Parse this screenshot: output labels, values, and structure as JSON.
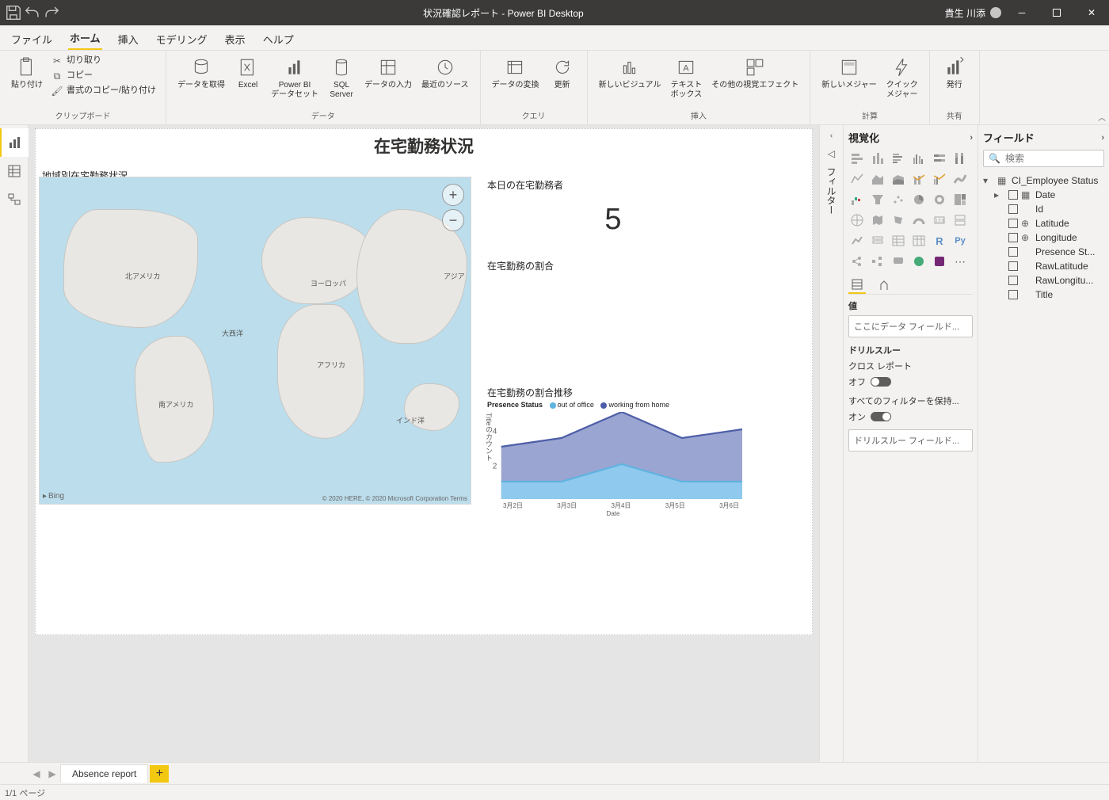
{
  "app_title": "状況確認レポート - Power BI Desktop",
  "user_name": "貴生 川添",
  "ribbon_tabs": [
    "ファイル",
    "ホーム",
    "挿入",
    "モデリング",
    "表示",
    "ヘルプ"
  ],
  "active_tab": "ホーム",
  "ribbon": {
    "clipboard": {
      "label": "クリップボード",
      "paste": "貼り付け",
      "cut": "切り取り",
      "copy": "コピー",
      "format_painter": "書式のコピー/貼り付け"
    },
    "data": {
      "label": "データ",
      "get_data": "データを取得",
      "excel": "Excel",
      "pbi_dataset": "Power BI\nデータセット",
      "sql": "SQL\nServer",
      "enter_data": "データの入力",
      "recent": "最近のソース"
    },
    "query": {
      "label": "クエリ",
      "transform": "データの変換",
      "refresh": "更新"
    },
    "insert": {
      "label": "挿入",
      "new_visual": "新しいビジュアル",
      "text_box": "テキスト\nボックス",
      "more_visuals": "その他の視覚エフェクト"
    },
    "calc": {
      "label": "計算",
      "new_measure": "新しいメジャー",
      "quick_measure": "クイック\nメジャー"
    },
    "share": {
      "label": "共有",
      "publish": "発行"
    }
  },
  "report": {
    "title": "在宅勤務状況",
    "map_title": "地域別在宅勤務状況",
    "map_labels": {
      "na": "北アメリカ",
      "sa": "南アメリカ",
      "eu": "ヨーロッパ",
      "af": "アフリカ",
      "as": "アジア",
      "indian": "インド洋",
      "pacific": "大西洋"
    },
    "map_credit": "© 2020 HERE, © 2020 Microsoft Corporation Terms",
    "map_bing": "Bing",
    "kpi_title": "本日の在宅勤務者",
    "kpi_value": "5",
    "ratio_title": "在宅勤務の割合",
    "trend_title": "在宅勤務の割合推移",
    "trend_legend_title": "Presence Status",
    "trend_series1": "out of office",
    "trend_series2": "working from home",
    "trend_ylabel": "Titleのカウント",
    "trend_xlabel": "Date"
  },
  "chart_data": {
    "type": "area",
    "x": [
      "3月2日",
      "3月3日",
      "3月4日",
      "3月5日",
      "3月6日"
    ],
    "series": [
      {
        "name": "working from home",
        "color": "#4d5ea8",
        "values": [
          3,
          3.5,
          5,
          3.5,
          4
        ]
      },
      {
        "name": "out of office",
        "color": "#5fb3e0",
        "values": [
          1,
          1,
          2,
          1,
          1
        ]
      }
    ],
    "ylim": [
      0,
      5
    ],
    "yticks": [
      2,
      4
    ],
    "xlabel": "Date",
    "ylabel": "Titleのカウント"
  },
  "filters_label": "フィルター",
  "vis_panel": {
    "title": "視覚化",
    "values_label": "値",
    "drop_hint": "ここにデータ フィールド...",
    "drill_title": "ドリルスルー",
    "cross_report": "クロス レポート",
    "off": "オフ",
    "keep_filters": "すべてのフィルターを保持...",
    "on": "オン",
    "drill_drop": "ドリルスルー フィールド..."
  },
  "fields_panel": {
    "title": "フィールド",
    "search_placeholder": "検索",
    "table": "CI_Employee Status",
    "columns": [
      "Date",
      "Id",
      "Latitude",
      "Longitude",
      "Presence St...",
      "RawLatitude",
      "RawLongitu...",
      "Title"
    ]
  },
  "page_tab": "Absence report",
  "status": "1/1 ページ"
}
